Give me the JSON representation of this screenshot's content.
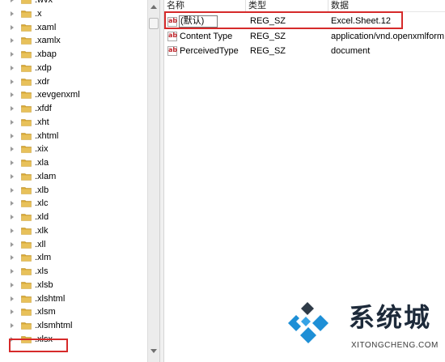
{
  "tree": {
    "items": [
      ".wvx",
      ".x",
      ".xaml",
      ".xamlx",
      ".xbap",
      ".xdp",
      ".xdr",
      ".xevgenxml",
      ".xfdf",
      ".xht",
      ".xhtml",
      ".xix",
      ".xla",
      ".xlam",
      ".xlb",
      ".xlc",
      ".xld",
      ".xlk",
      ".xll",
      ".xlm",
      ".xls",
      ".xlsb",
      ".xlshtml",
      ".xlsm",
      ".xlsmhtml",
      ".xlsx"
    ],
    "selected": ".xlsx"
  },
  "list": {
    "columns": {
      "name": "名称",
      "type": "类型",
      "data": "数据"
    },
    "rows": [
      {
        "name": "(默认)",
        "type": "REG_SZ",
        "data": "Excel.Sheet.12"
      },
      {
        "name": "Content Type",
        "type": "REG_SZ",
        "data": "application/vnd.openxmlform"
      },
      {
        "name": "PerceivedType",
        "type": "REG_SZ",
        "data": "document"
      }
    ],
    "value_icon": "string-value-ab-icon"
  },
  "watermark": {
    "title": "系统城",
    "subtitle": "XITONGCHENG.COM"
  },
  "colors": {
    "highlight": "#d62a2a",
    "folder": "#e8c15a",
    "logo_blue": "#1e8fd6",
    "logo_dark": "#1d2a3a"
  }
}
